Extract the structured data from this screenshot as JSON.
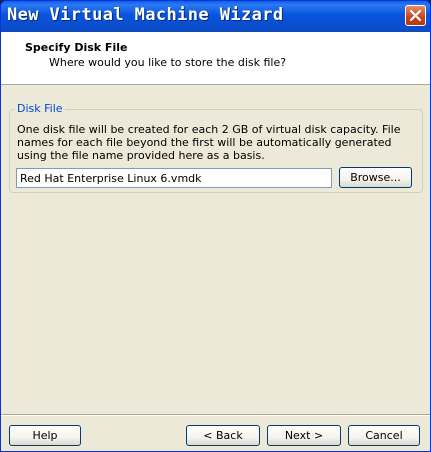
{
  "window": {
    "title": "New Virtual Machine Wizard"
  },
  "header": {
    "title": "Specify Disk File",
    "subtitle": "Where would you like to store the disk file?"
  },
  "disk_file_group": {
    "legend": "Disk File",
    "description": "One disk file will be created for each 2 GB of virtual disk capacity. File names for each file beyond the first will be automatically generated using the file name provided here as a basis.",
    "file_name_value": "Red Hat Enterprise Linux 6.vmdk",
    "browse_label": "Browse..."
  },
  "footer": {
    "help_label": "Help",
    "back_label": "< Back",
    "next_label": "Next >",
    "cancel_label": "Cancel"
  },
  "icons": {
    "close": "close-icon"
  },
  "colors": {
    "titlebar": "#0855dd",
    "dialog_background": "#ece9d8",
    "legend_text": "#0046d5",
    "close_button": "#c9431b"
  }
}
